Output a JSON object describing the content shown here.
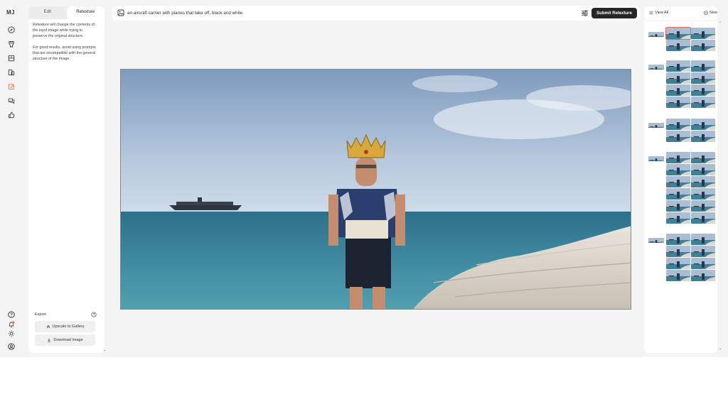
{
  "app": {
    "logo": "MJ"
  },
  "rail": {
    "items": [
      {
        "name": "explore-icon"
      },
      {
        "name": "create-icon"
      },
      {
        "name": "archive-icon"
      },
      {
        "name": "personalize-icon"
      },
      {
        "name": "edit-icon",
        "active": true
      },
      {
        "name": "chat-icon"
      },
      {
        "name": "tasks-icon"
      }
    ],
    "bottom": [
      {
        "name": "help-icon"
      },
      {
        "name": "notifications-icon"
      },
      {
        "name": "theme-icon"
      },
      {
        "name": "profile-icon"
      }
    ]
  },
  "left_panel": {
    "tabs": [
      {
        "label": "Edit",
        "active": false
      },
      {
        "label": "Retexture",
        "active": true
      }
    ],
    "info_1": "Retexture will change the contents of the input image while trying to preserve the original structure.",
    "info_2": "For good results, avoid using prompts that are incompatible with the general structure of the image.",
    "export_label": "Export",
    "upscale_label": "Upscale to Gallery",
    "download_label": "Download Image"
  },
  "prompt": {
    "text": "an aircraft carrier with planes that take off, black and white",
    "submit_label": "Submit Retexture"
  },
  "right_panel": {
    "view_all_label": "View All",
    "new_label": "New"
  },
  "colors": {
    "accent": "#e86a54",
    "submit_bg": "#262626",
    "panel_bg": "#ffffff",
    "app_bg": "#f4f4f4"
  }
}
